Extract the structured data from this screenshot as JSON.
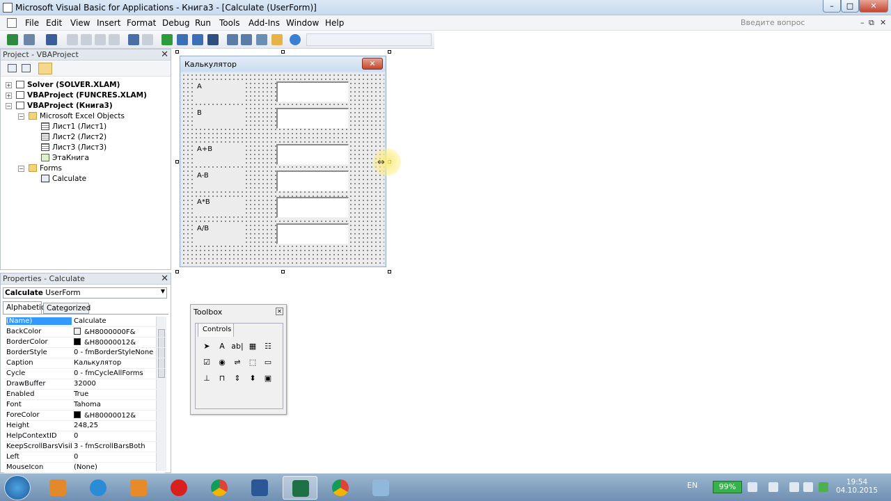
{
  "window": {
    "title": "Microsoft Visual Basic for Applications - Книга3 - [Calculate (UserForm)]",
    "minimize": "–",
    "maximize": "□",
    "close": "✕"
  },
  "menubar": {
    "items": [
      "File",
      "Edit",
      "View",
      "Insert",
      "Format",
      "Debug",
      "Run",
      "Tools",
      "Add-Ins",
      "Window",
      "Help"
    ],
    "help_placeholder": "Введите вопрос",
    "mdi": [
      "–",
      "⧉",
      "✕"
    ]
  },
  "project": {
    "title": "Project - VBAProject",
    "close": "✕",
    "nodes": [
      {
        "label": "Solver (SOLVER.XLAM)",
        "expander": "+"
      },
      {
        "label": "VBAProject (FUNCRES.XLAM)",
        "expander": "+"
      },
      {
        "label": "VBAProject (Книга3)",
        "expander": "−"
      },
      {
        "label": "Microsoft Excel Objects",
        "expander": "−"
      },
      {
        "label": "Лист1 (Лист1)"
      },
      {
        "label": "Лист2 (Лист2)"
      },
      {
        "label": "Лист3 (Лист3)"
      },
      {
        "label": "ЭтаКнига"
      },
      {
        "label": "Forms",
        "expander": "−"
      },
      {
        "label": "Calculate"
      }
    ]
  },
  "properties": {
    "title": "Properties - Calculate",
    "close": "✕",
    "object_name": "Calculate",
    "object_type": "UserForm",
    "tabs": [
      "Alphabetic",
      "Categorized"
    ],
    "rows": [
      {
        "name": "(Name)",
        "value": "Calculate"
      },
      {
        "name": "BackColor",
        "value": "&H8000000F&",
        "swatch": "#f0f0f0"
      },
      {
        "name": "BorderColor",
        "value": "&H80000012&",
        "swatch": "#000000"
      },
      {
        "name": "BorderStyle",
        "value": "0 - fmBorderStyleNone"
      },
      {
        "name": "Caption",
        "value": "Калькулятор"
      },
      {
        "name": "Cycle",
        "value": "0 - fmCycleAllForms"
      },
      {
        "name": "DrawBuffer",
        "value": "32000"
      },
      {
        "name": "Enabled",
        "value": "True"
      },
      {
        "name": "Font",
        "value": "Tahoma"
      },
      {
        "name": "ForeColor",
        "value": "&H80000012&",
        "swatch": "#000000"
      },
      {
        "name": "Height",
        "value": "248,25"
      },
      {
        "name": "HelpContextID",
        "value": "0"
      },
      {
        "name": "KeepScrollBarsVisible",
        "value": "3 - fmScrollBarsBoth"
      },
      {
        "name": "Left",
        "value": "0"
      },
      {
        "name": "MouseIcon",
        "value": "(None)"
      }
    ]
  },
  "userform": {
    "caption": "Калькулятор",
    "close": "✕",
    "labels": [
      "A",
      "B",
      "A+B",
      "A-B",
      "A*B",
      "A/B"
    ]
  },
  "toolbox": {
    "title": "Toolbox",
    "close": "✕",
    "tab": "Controls",
    "tools": [
      "pointer-tool",
      "label-tool",
      "textbox-tool",
      "combobox-tool",
      "listbox-tool",
      "checkbox-tool",
      "optionbutton-tool",
      "togglebutton-tool",
      "frame-tool",
      "commandbutton-tool",
      "tabstrip-tool",
      "multipage-tool",
      "scrollbar-tool",
      "spinbutton-tool",
      "image-tool"
    ],
    "glyphs": [
      "➤",
      "A",
      "ab|",
      "▦",
      "☷",
      "☑",
      "◉",
      "⇌",
      "⬚",
      "▭",
      "⊥",
      "⊓",
      "⇕",
      "⬍",
      "▣"
    ]
  },
  "taskbar": {
    "lang": "EN",
    "battery": "99%",
    "time": "19:54",
    "date": "04.10.2015"
  }
}
